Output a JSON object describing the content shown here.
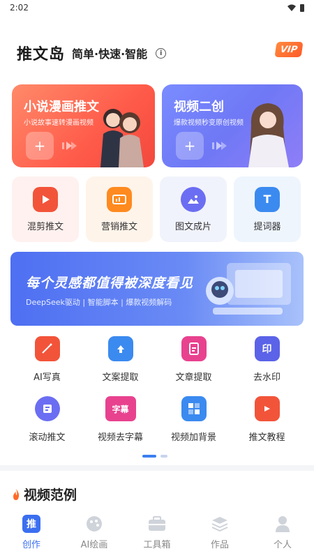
{
  "status_bar": {
    "time": "2:02"
  },
  "header": {
    "app_name": "推文岛",
    "slogan": "简单·快速·智能",
    "vip": "VIP"
  },
  "cards": [
    {
      "title": "小说漫画推文",
      "subtitle": "小说故事速转漫画视频"
    },
    {
      "title": "视频二创",
      "subtitle": "爆款视频秒变原创视频"
    }
  ],
  "tools": [
    {
      "label": "混剪推文",
      "icon": "play-icon",
      "color": "#f2543a"
    },
    {
      "label": "营销推文",
      "icon": "megaphone-icon",
      "color": "#ff8a1f"
    },
    {
      "label": "图文成片",
      "icon": "image-icon",
      "color": "#6b6ef2"
    },
    {
      "label": "提词器",
      "icon": "text-icon",
      "color": "#3b8af0"
    }
  ],
  "banner": {
    "title": "每个灵感都值得被深度看见",
    "subtitle": "DeepSeek驱动 | 智能脚本 | 爆款视频解码"
  },
  "grid": [
    {
      "label": "AI写真",
      "icon": "magic-camera-icon",
      "color": "#f2543a"
    },
    {
      "label": "文案提取",
      "icon": "folder-upload-icon",
      "color": "#3b8af0"
    },
    {
      "label": "文章提取",
      "icon": "document-icon",
      "color": "#e8428f"
    },
    {
      "label": "去水印",
      "icon": "stamp-icon",
      "color": "#5b63e8"
    },
    {
      "label": "滚动推文",
      "icon": "scroll-text-icon",
      "color": "#6b6ef2"
    },
    {
      "label": "视频去字幕",
      "icon": "subtitle-remove-icon",
      "color": "#e8428f",
      "glyph": "字幕"
    },
    {
      "label": "视频加背景",
      "icon": "background-icon",
      "color": "#3b8af0"
    },
    {
      "label": "推文教程",
      "icon": "book-icon",
      "color": "#f2543a"
    }
  ],
  "section": {
    "title": "视频范例"
  },
  "tabbar": [
    {
      "label": "创作",
      "icon": "create-icon",
      "glyph": "推"
    },
    {
      "label": "AI绘画",
      "icon": "palette-icon"
    },
    {
      "label": "工具箱",
      "icon": "toolbox-icon"
    },
    {
      "label": "作品",
      "icon": "layers-icon"
    },
    {
      "label": "个人",
      "icon": "user-icon"
    }
  ]
}
